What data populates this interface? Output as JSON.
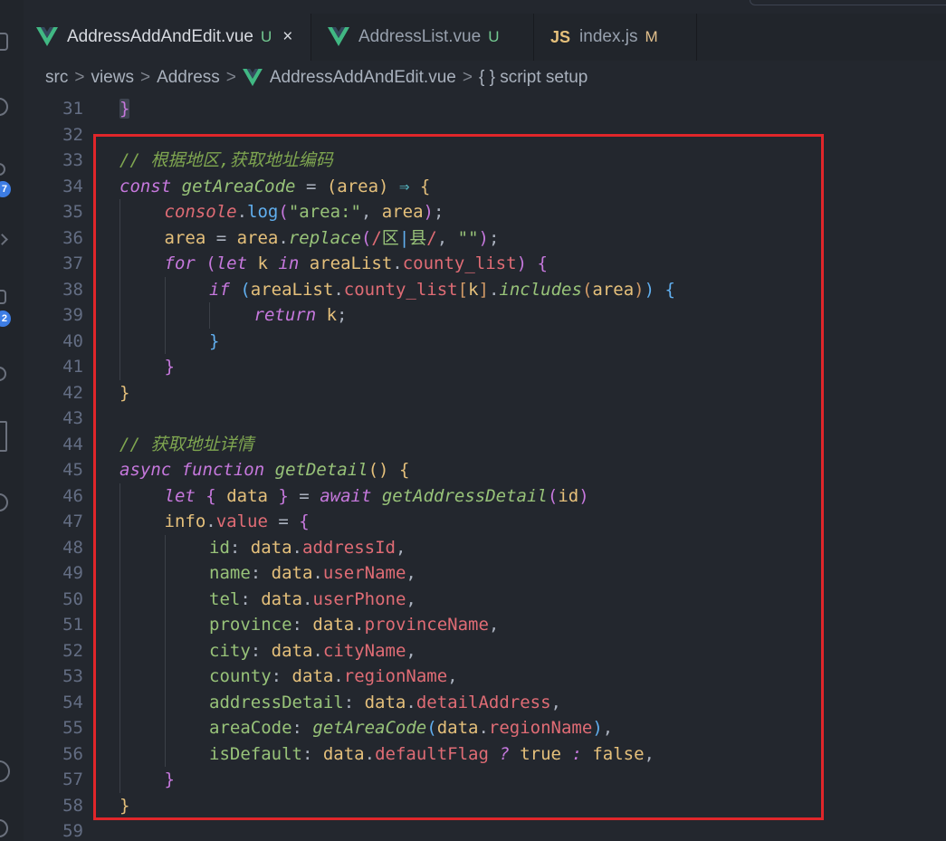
{
  "tabs": [
    {
      "name": "AddressAddAndEdit.vue",
      "status": "U",
      "active": true,
      "type": "vue",
      "close": "×"
    },
    {
      "name": "AddressList.vue",
      "status": "U",
      "active": false,
      "type": "vue"
    },
    {
      "name": "index.js",
      "status": "M",
      "active": false,
      "type": "js",
      "type_label": "JS"
    }
  ],
  "breadcrumb": {
    "items": [
      "src",
      "views",
      "Address",
      "AddressAddAndEdit.vue",
      "{ } script setup"
    ],
    "separator": ">"
  },
  "activity_bar": {
    "badges": [
      "7",
      "2"
    ],
    "icons": [
      "files-icon",
      "search-icon",
      "source-control-icon",
      "run-debug-icon",
      "extensions-icon",
      "remote-icon",
      "testing-icon",
      "timeline-icon",
      "account-icon",
      "settings-icon"
    ]
  },
  "editor": {
    "line_numbers": [
      "31",
      "32",
      "33",
      "34",
      "35",
      "36",
      "37",
      "38",
      "39",
      "40",
      "41",
      "42",
      "43",
      "44",
      "45",
      "46",
      "47",
      "48",
      "49",
      "50",
      "51",
      "52",
      "53",
      "54",
      "55",
      "56",
      "57",
      "58",
      "59"
    ],
    "lines": [
      {
        "n": "31",
        "indent": 0,
        "tokens": [
          [
            "}",
            "b2 cur-brace"
          ]
        ]
      },
      {
        "n": "32",
        "indent": 0,
        "tokens": []
      },
      {
        "n": "33",
        "indent": 0,
        "tokens": [
          [
            "// 根据地区,获取地址编码",
            "cmt"
          ]
        ]
      },
      {
        "n": "34",
        "indent": 0,
        "tokens": [
          [
            "const",
            "kw"
          ],
          [
            " ",
            "pun"
          ],
          [
            "getAreaCode",
            "fn"
          ],
          [
            " = ",
            "pun"
          ],
          [
            "(",
            "b1"
          ],
          [
            "area",
            "var"
          ],
          [
            ")",
            "b1"
          ],
          [
            " ⇒ ",
            "op"
          ],
          [
            "{",
            "b1"
          ]
        ]
      },
      {
        "n": "35",
        "indent": 1,
        "tokens": [
          [
            "console",
            "prop it"
          ],
          [
            ".",
            "pun"
          ],
          [
            "log",
            "fncall"
          ],
          [
            "(",
            "b2"
          ],
          [
            "\"area:\"",
            "str"
          ],
          [
            ", ",
            "pun"
          ],
          [
            "area",
            "var"
          ],
          [
            ")",
            "b2"
          ],
          [
            ";",
            "pun"
          ]
        ]
      },
      {
        "n": "36",
        "indent": 1,
        "tokens": [
          [
            "area",
            "var"
          ],
          [
            " = ",
            "pun"
          ],
          [
            "area",
            "var"
          ],
          [
            ".",
            "pun"
          ],
          [
            "replace",
            "fn"
          ],
          [
            "(",
            "b2"
          ],
          [
            "/",
            "re"
          ],
          [
            "区",
            "str"
          ],
          [
            "|",
            "b3"
          ],
          [
            "县",
            "str"
          ],
          [
            "/",
            "re"
          ],
          [
            ", ",
            "pun"
          ],
          [
            "\"\"",
            "str"
          ],
          [
            ")",
            "b2"
          ],
          [
            ";",
            "pun"
          ]
        ]
      },
      {
        "n": "37",
        "indent": 1,
        "tokens": [
          [
            "for",
            "kw"
          ],
          [
            " ",
            "pun"
          ],
          [
            "(",
            "b2"
          ],
          [
            "let",
            "kw"
          ],
          [
            " ",
            "pun"
          ],
          [
            "k",
            "var"
          ],
          [
            " ",
            "pun"
          ],
          [
            "in",
            "kw"
          ],
          [
            " ",
            "pun"
          ],
          [
            "areaList",
            "var"
          ],
          [
            ".",
            "pun"
          ],
          [
            "county_list",
            "prop"
          ],
          [
            ")",
            "b2"
          ],
          [
            " ",
            "pun"
          ],
          [
            "{",
            "b2"
          ]
        ]
      },
      {
        "n": "38",
        "indent": 2,
        "tokens": [
          [
            "if",
            "kw"
          ],
          [
            " ",
            "pun"
          ],
          [
            "(",
            "b3"
          ],
          [
            "areaList",
            "var"
          ],
          [
            ".",
            "pun"
          ],
          [
            "county_list",
            "prop"
          ],
          [
            "[",
            "b4"
          ],
          [
            "k",
            "var"
          ],
          [
            "]",
            "b4"
          ],
          [
            ".",
            "pun"
          ],
          [
            "includes",
            "fn"
          ],
          [
            "(",
            "b4"
          ],
          [
            "area",
            "var"
          ],
          [
            ")",
            "b4"
          ],
          [
            ")",
            "b3"
          ],
          [
            " ",
            "pun"
          ],
          [
            "{",
            "b3"
          ]
        ]
      },
      {
        "n": "39",
        "indent": 3,
        "tokens": [
          [
            "return",
            "kw"
          ],
          [
            " ",
            "pun"
          ],
          [
            "k",
            "var"
          ],
          [
            ";",
            "pun"
          ]
        ]
      },
      {
        "n": "40",
        "indent": 2,
        "tokens": [
          [
            "}",
            "b3"
          ]
        ]
      },
      {
        "n": "41",
        "indent": 1,
        "tokens": [
          [
            "}",
            "b2"
          ]
        ]
      },
      {
        "n": "42",
        "indent": 0,
        "tokens": [
          [
            "}",
            "b1"
          ]
        ]
      },
      {
        "n": "43",
        "indent": 0,
        "tokens": []
      },
      {
        "n": "44",
        "indent": 0,
        "tokens": [
          [
            "// 获取地址详情",
            "cmt"
          ]
        ]
      },
      {
        "n": "45",
        "indent": 0,
        "tokens": [
          [
            "async",
            "kw"
          ],
          [
            " ",
            "pun"
          ],
          [
            "function",
            "kw"
          ],
          [
            " ",
            "pun"
          ],
          [
            "getDetail",
            "fn"
          ],
          [
            "(",
            "b1"
          ],
          [
            ")",
            "b1"
          ],
          [
            " ",
            "pun"
          ],
          [
            "{",
            "b1"
          ]
        ]
      },
      {
        "n": "46",
        "indent": 1,
        "tokens": [
          [
            "let",
            "kw"
          ],
          [
            " ",
            "pun"
          ],
          [
            "{",
            "b2"
          ],
          [
            " ",
            "pun"
          ],
          [
            "data",
            "var"
          ],
          [
            " ",
            "pun"
          ],
          [
            "}",
            "b2"
          ],
          [
            " = ",
            "pun"
          ],
          [
            "await",
            "kw"
          ],
          [
            " ",
            "pun"
          ],
          [
            "getAddressDetail",
            "fn"
          ],
          [
            "(",
            "b2"
          ],
          [
            "id",
            "var"
          ],
          [
            ")",
            "b2"
          ]
        ]
      },
      {
        "n": "47",
        "indent": 1,
        "tokens": [
          [
            "info",
            "var"
          ],
          [
            ".",
            "pun"
          ],
          [
            "value",
            "prop"
          ],
          [
            " = ",
            "pun"
          ],
          [
            "{",
            "b2"
          ]
        ]
      },
      {
        "n": "48",
        "indent": 2,
        "tokens": [
          [
            "id",
            "key"
          ],
          [
            ": ",
            "pun"
          ],
          [
            "data",
            "var"
          ],
          [
            ".",
            "pun"
          ],
          [
            "addressId",
            "prop"
          ],
          [
            ",",
            "pun"
          ]
        ]
      },
      {
        "n": "49",
        "indent": 2,
        "tokens": [
          [
            "name",
            "key"
          ],
          [
            ": ",
            "pun"
          ],
          [
            "data",
            "var"
          ],
          [
            ".",
            "pun"
          ],
          [
            "userName",
            "prop"
          ],
          [
            ",",
            "pun"
          ]
        ]
      },
      {
        "n": "50",
        "indent": 2,
        "tokens": [
          [
            "tel",
            "key"
          ],
          [
            ": ",
            "pun"
          ],
          [
            "data",
            "var"
          ],
          [
            ".",
            "pun"
          ],
          [
            "userPhone",
            "prop"
          ],
          [
            ",",
            "pun"
          ]
        ]
      },
      {
        "n": "51",
        "indent": 2,
        "tokens": [
          [
            "province",
            "key"
          ],
          [
            ": ",
            "pun"
          ],
          [
            "data",
            "var"
          ],
          [
            ".",
            "pun"
          ],
          [
            "provinceName",
            "prop"
          ],
          [
            ",",
            "pun"
          ]
        ]
      },
      {
        "n": "52",
        "indent": 2,
        "tokens": [
          [
            "city",
            "key"
          ],
          [
            ": ",
            "pun"
          ],
          [
            "data",
            "var"
          ],
          [
            ".",
            "pun"
          ],
          [
            "cityName",
            "prop"
          ],
          [
            ",",
            "pun"
          ]
        ]
      },
      {
        "n": "53",
        "indent": 2,
        "tokens": [
          [
            "county",
            "key"
          ],
          [
            ": ",
            "pun"
          ],
          [
            "data",
            "var"
          ],
          [
            ".",
            "pun"
          ],
          [
            "regionName",
            "prop"
          ],
          [
            ",",
            "pun"
          ]
        ]
      },
      {
        "n": "54",
        "indent": 2,
        "tokens": [
          [
            "addressDetail",
            "key"
          ],
          [
            ": ",
            "pun"
          ],
          [
            "data",
            "var"
          ],
          [
            ".",
            "pun"
          ],
          [
            "detailAddress",
            "prop"
          ],
          [
            ",",
            "pun"
          ]
        ]
      },
      {
        "n": "55",
        "indent": 2,
        "tokens": [
          [
            "areaCode",
            "key"
          ],
          [
            ": ",
            "pun"
          ],
          [
            "getAreaCode",
            "fn"
          ],
          [
            "(",
            "b3"
          ],
          [
            "data",
            "var"
          ],
          [
            ".",
            "pun"
          ],
          [
            "regionName",
            "prop"
          ],
          [
            ")",
            "b3"
          ],
          [
            ",",
            "pun"
          ]
        ]
      },
      {
        "n": "56",
        "indent": 2,
        "tokens": [
          [
            "isDefault",
            "key"
          ],
          [
            ": ",
            "pun"
          ],
          [
            "data",
            "var"
          ],
          [
            ".",
            "pun"
          ],
          [
            "defaultFlag",
            "prop"
          ],
          [
            " ? ",
            "kw"
          ],
          [
            "true",
            "bool"
          ],
          [
            " : ",
            "kw"
          ],
          [
            "false",
            "bool"
          ],
          [
            ",",
            "pun"
          ]
        ]
      },
      {
        "n": "57",
        "indent": 1,
        "tokens": [
          [
            "}",
            "b2"
          ]
        ]
      },
      {
        "n": "58",
        "indent": 0,
        "tokens": [
          [
            "}",
            "b1"
          ]
        ]
      },
      {
        "n": "59",
        "indent": 0,
        "tokens": []
      }
    ]
  },
  "colors": {
    "editor_bg": "#23272e",
    "highlight_box": "#e0262a",
    "vue_green": "#41b883",
    "git_untracked": "#73c991",
    "git_modified": "#e2c08d"
  }
}
